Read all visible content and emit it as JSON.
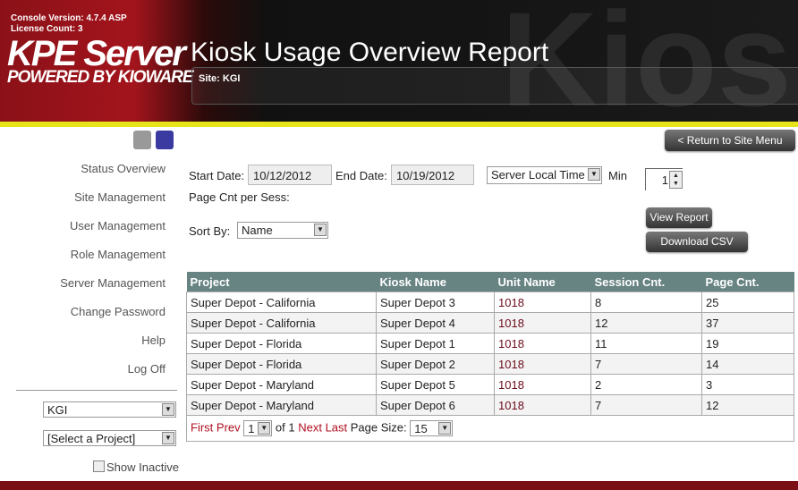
{
  "header": {
    "console_version": "Console Version: 4.7.4 ASP",
    "license_count": "License Count: 3",
    "logo": "KPE Server",
    "tagline": "POWERED BY KIOWARE",
    "watermark": "Kiosk Pro",
    "title": "Kiosk Usage Overview Report",
    "site": "Site: KGI"
  },
  "sidebar": {
    "items": [
      "Status Overview",
      "Site Management",
      "User Management",
      "Role Management",
      "Server Management",
      "Change Password",
      "Help",
      "Log Off"
    ],
    "site_select": "KGI",
    "project_select": "[Select a Project]",
    "show_inactive": "Show Inactive"
  },
  "filters": {
    "start_label": "Start Date:",
    "start": "10/12/2012",
    "end_label": "End Date:",
    "end": "10/19/2012",
    "tz": "Server Local Time",
    "min_label": "Min",
    "min_value": "1",
    "page_cnt_label": "Page Cnt per Sess:",
    "sort_label": "Sort By:",
    "sort": "Name"
  },
  "buttons": {
    "return": "< Return to Site Menu",
    "view": "View Report",
    "csv": "Download CSV"
  },
  "table": {
    "headers": [
      "Project",
      "Kiosk Name",
      "Unit Name",
      "Session Cnt.",
      "Page Cnt."
    ],
    "rows": [
      [
        "Super Depot - California",
        "Super Depot 3",
        "1018",
        "8",
        "25"
      ],
      [
        "Super Depot - California",
        "Super Depot 4",
        "1018",
        "12",
        "37"
      ],
      [
        "Super Depot - Florida",
        "Super Depot 1",
        "1018",
        "11",
        "19"
      ],
      [
        "Super Depot - Florida",
        "Super Depot 2",
        "1018",
        "7",
        "14"
      ],
      [
        "Super Depot - Maryland",
        "Super Depot 5",
        "1018",
        "2",
        "3"
      ],
      [
        "Super Depot - Maryland",
        "Super Depot 6",
        "1018",
        "7",
        "12"
      ]
    ]
  },
  "pager": {
    "first": "First",
    "prev": "Prev",
    "page": "1",
    "of": "of 1",
    "next": "Next",
    "last": "Last",
    "size_label": "Page Size:",
    "size": "15"
  }
}
